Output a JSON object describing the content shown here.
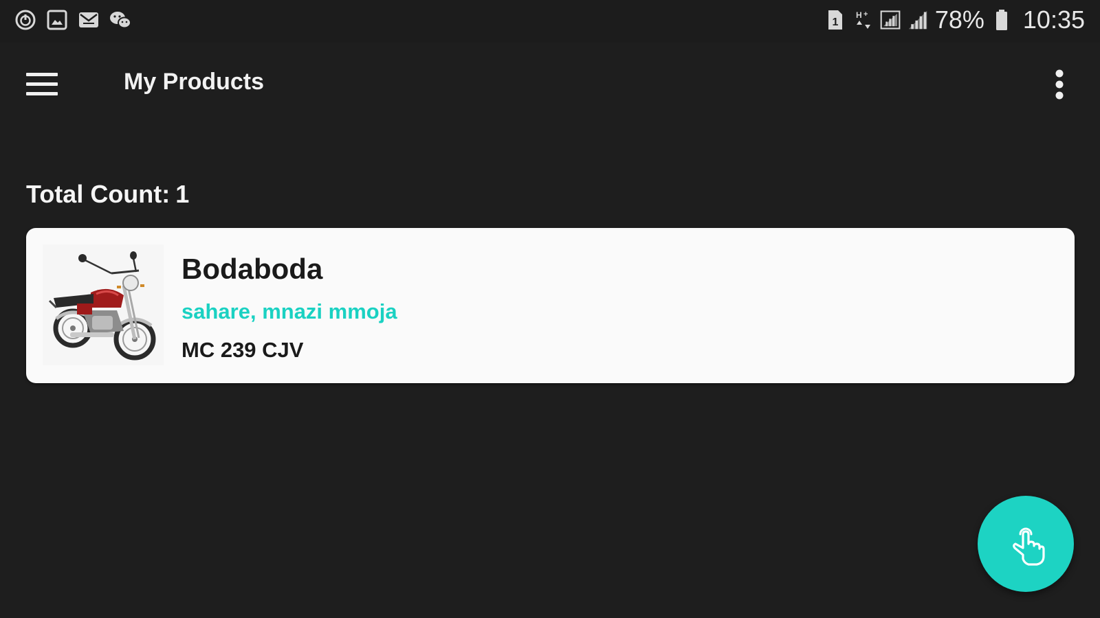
{
  "status_bar": {
    "left_icons": [
      "power-icon",
      "image-icon",
      "mail-icon",
      "chat-icon"
    ],
    "right_icons": [
      "sim-1-icon",
      "data-transfer-icon",
      "signal-box-icon",
      "signal-bars-icon"
    ],
    "battery": "78%",
    "time": "10:35"
  },
  "app_bar": {
    "title": "My Products",
    "menu_icon": "hamburger-menu-icon",
    "overflow_icon": "more-vert-icon"
  },
  "content": {
    "total_count_label": "Total Count:",
    "total_count_value": "1"
  },
  "products": [
    {
      "name": "Bodaboda",
      "location": "sahare, mnazi mmoja",
      "plate": "MC 239 CJV",
      "thumbnail": "motorcycle-image"
    }
  ],
  "fab": {
    "icon": "touch-hand-icon"
  },
  "colors": {
    "background": "#1e1e1e",
    "card": "#fafafa",
    "accent": "#1dd3c3",
    "location_text": "#1ad1c2"
  }
}
